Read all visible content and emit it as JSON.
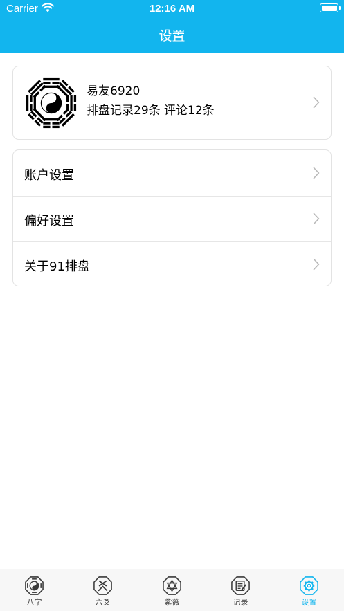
{
  "status_bar": {
    "carrier": "Carrier",
    "time": "12:16 AM"
  },
  "nav": {
    "title": "设置"
  },
  "profile": {
    "username": "易友6920",
    "stats": "排盘记录29条 评论12条"
  },
  "menu": [
    {
      "label": "账户设置"
    },
    {
      "label": "偏好设置"
    },
    {
      "label": "关于91排盘"
    }
  ],
  "tabs": [
    {
      "label": "八字",
      "icon": "bagua-icon",
      "active": false
    },
    {
      "label": "六爻",
      "icon": "liuyao-icon",
      "active": false
    },
    {
      "label": "紫薇",
      "icon": "star-of-david-icon",
      "active": false
    },
    {
      "label": "记录",
      "icon": "notebook-icon",
      "active": false
    },
    {
      "label": "设置",
      "icon": "gear-icon",
      "active": true
    }
  ],
  "colors": {
    "accent": "#12b5ee",
    "tab_inactive": "#3a3a3a",
    "card_border": "#e3e3e3"
  }
}
